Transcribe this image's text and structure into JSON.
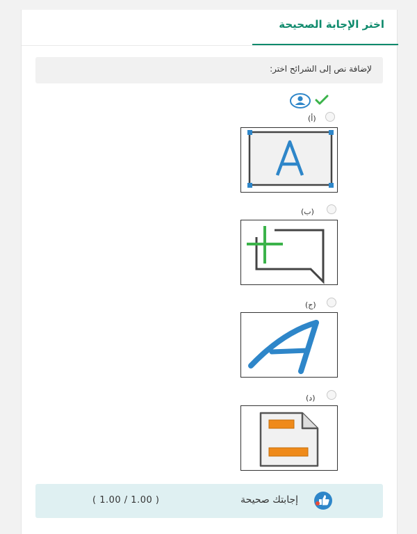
{
  "question": {
    "title": "اختر الإجابة الصحيحة",
    "prompt": "لإضافة نص إلى الشرائح اختر:"
  },
  "options": [
    {
      "label": "(أ)",
      "icon": "text-box-a-icon"
    },
    {
      "label": "(ب)",
      "icon": "add-comment-icon"
    },
    {
      "label": "(ج)",
      "icon": "wordart-a-icon"
    },
    {
      "label": "(د)",
      "icon": "header-footer-document-icon"
    }
  ],
  "feedback": {
    "message": "إجابتك صحيحة",
    "score": "( 1.00 / 1.00 )",
    "icon": "thumbs-up-icon"
  },
  "colors": {
    "accent": "#0e8a6c",
    "correct": "#3bb34a",
    "feedback_bg": "#dff0f2",
    "icon_blue": "#2e86c9",
    "icon_orange": "#ef8a1a"
  }
}
